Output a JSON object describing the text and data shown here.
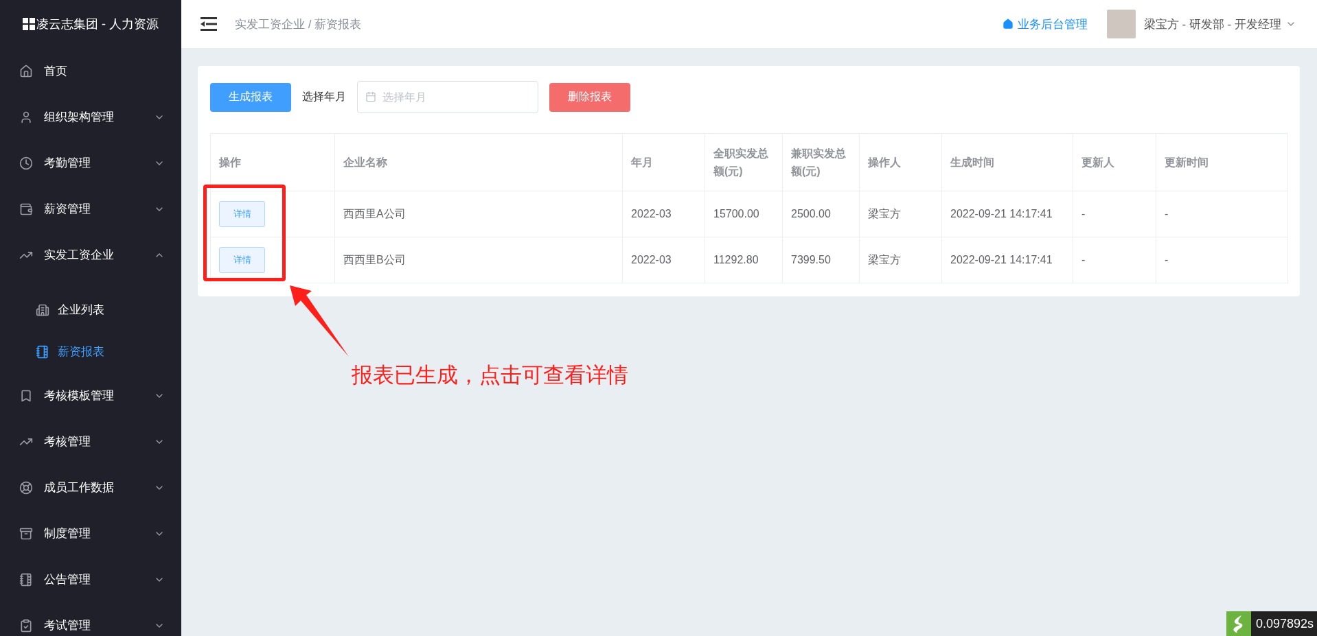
{
  "app_title": "凌云志集团 - 人力资源",
  "sidebar": {
    "items": [
      {
        "label": "首页"
      },
      {
        "label": "组织架构管理",
        "expanded": false
      },
      {
        "label": "考勤管理",
        "expanded": false
      },
      {
        "label": "薪资管理",
        "expanded": false
      },
      {
        "label": "实发工资企业",
        "expanded": true,
        "children": [
          {
            "label": "企业列表",
            "selected": false
          },
          {
            "label": "薪资报表",
            "selected": true
          }
        ]
      },
      {
        "label": "考核模板管理",
        "expanded": false
      },
      {
        "label": "考核管理",
        "expanded": false
      },
      {
        "label": "成员工作数据",
        "expanded": false
      },
      {
        "label": "制度管理",
        "expanded": false
      },
      {
        "label": "公告管理",
        "expanded": false
      },
      {
        "label": "考试管理",
        "expanded": false
      }
    ]
  },
  "header": {
    "breadcrumb": "实发工资企业 / 薪资报表",
    "admin_link": "业务后台管理",
    "user": "梁宝方 - 研发部 - 开发经理"
  },
  "toolbar": {
    "generate_button": "生成报表",
    "month_label": "选择年月",
    "month_field": {
      "placeholder": "选择年月"
    },
    "delete_button": "删除报表"
  },
  "table": {
    "columns": [
      "操作",
      "企业名称",
      "年月",
      "全职实发总额(元)",
      "兼职实发总额(元)",
      "操作人",
      "生成时间",
      "更新人",
      "更新时间"
    ],
    "rows": [
      {
        "cells": [
          "详情",
          "西西里A公司",
          "2022-03",
          "15700.00",
          "2500.00",
          "梁宝方",
          "2022-09-21 14:17:41",
          "-",
          "-"
        ]
      },
      {
        "cells": [
          "详情",
          "西西里B公司",
          "2022-03",
          "11292.80",
          "7399.50",
          "梁宝方",
          "2022-09-21 14:17:41",
          "-",
          "-"
        ]
      }
    ]
  },
  "annotation": "报表已生成，点击可查看详情",
  "timing_badge": "0.097892s"
}
